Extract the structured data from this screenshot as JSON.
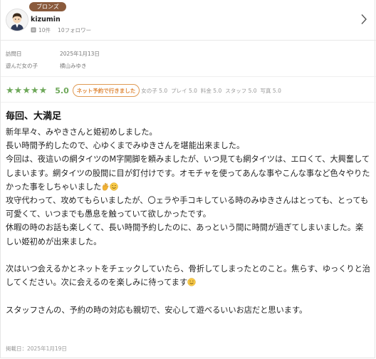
{
  "user": {
    "rank_badge": "ブロンズ",
    "name": "kizumin",
    "posts": "10件",
    "followers": "10フォロワー"
  },
  "visit": {
    "date_label": "訪問日",
    "date_value": "2025年1月13日",
    "girl_label": "遊んだ女の子",
    "girl_value": "横山みゆき"
  },
  "rating": {
    "stars": 5,
    "score": "5.0",
    "tag": "ネット予約で行きました",
    "subscores": [
      "女の子 5.0",
      "プレイ 5.0",
      "料金 5.0",
      "スタッフ 5.0",
      "写真 5.0"
    ]
  },
  "review": {
    "title": "毎回、大満足",
    "paragraphs": [
      "新年早々、みやきさんと姫初めしました。",
      "長い時間予約したので、心ゆくまでみゆきさんを堪能出来ました。",
      "今回は、夜這いの網タイツのM字開脚を頼みましたが、いつ見ても網タイツは、エロくて、大興奮してしまいます。網タイツの股間に目が釘付けです。オモチャを使ってあんな事やこんな事など色々やりたかった事をしちゃいました",
      "攻守代わって、攻めてもらいましたが、〇ェラや手コキしている時のみゆきさんはとっても、とっても可愛くて、いつまでも愚息を触っていて欲しかったです。",
      "休暇の時のお話も楽しくて、長い時間予約したのに、あっという間に時間が過ぎてしまいました。楽しい姫初めが出来ました。",
      "",
      "次はいつ会えるかとネットをチェックしていたら、骨折してしまったとのこと。焦らす、ゆっくりと治してください。次に会えるのを楽しみに待ってます",
      "",
      "スタッフさんの、予約の時の対応も親切で、安心して遊べるいいお店だと思います。"
    ],
    "posted": "掲載日：2025年1月19日"
  },
  "icons": {
    "avatar": "user-avatar-icon",
    "posts": "document-icon",
    "chevron": "chevron-right-icon",
    "emoji_ok": "ok-hand-emoji",
    "emoji_smile": "smile-emoji"
  },
  "colors": {
    "badge": "#8a5a3c",
    "star": "#6ea85a",
    "pill": "#e08a3c"
  }
}
